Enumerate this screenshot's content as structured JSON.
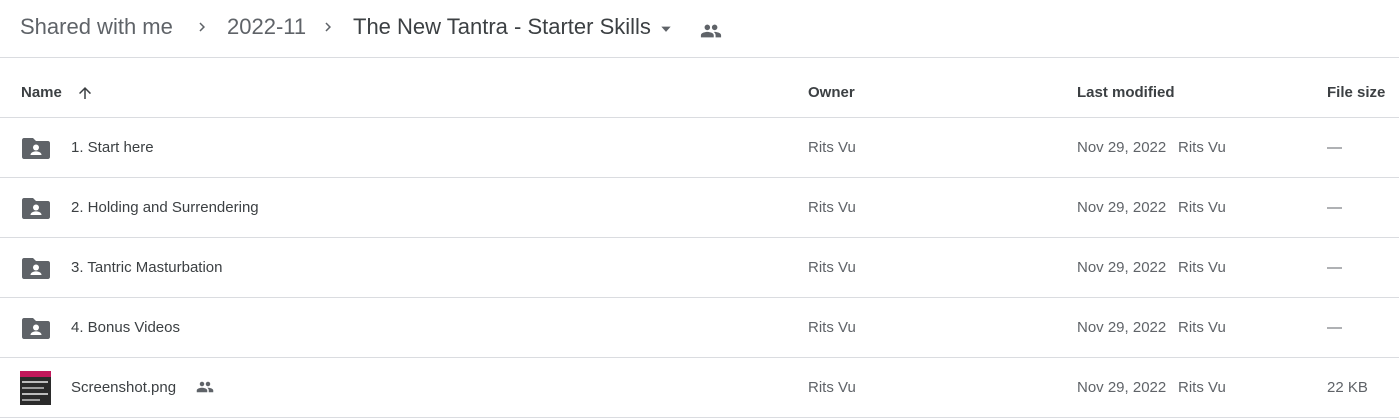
{
  "breadcrumb": {
    "items": [
      "Shared with me",
      "2022-11",
      "The New Tantra - Starter Skills"
    ]
  },
  "columns": {
    "name": "Name",
    "owner": "Owner",
    "last_modified": "Last modified",
    "file_size": "File size"
  },
  "sort": {
    "column": "Name",
    "direction": "ascending"
  },
  "files": [
    {
      "type": "shared-folder",
      "name": "1. Start here",
      "owner": "Rits Vu",
      "modified_date": "Nov 29, 2022",
      "modified_by": "Rits Vu",
      "size": "—"
    },
    {
      "type": "shared-folder",
      "name": "2. Holding and Surrendering",
      "owner": "Rits Vu",
      "modified_date": "Nov 29, 2022",
      "modified_by": "Rits Vu",
      "size": "—"
    },
    {
      "type": "shared-folder",
      "name": "3. Tantric Masturbation",
      "owner": "Rits Vu",
      "modified_date": "Nov 29, 2022",
      "modified_by": "Rits Vu",
      "size": "—"
    },
    {
      "type": "shared-folder",
      "name": "4. Bonus Videos",
      "owner": "Rits Vu",
      "modified_date": "Nov 29, 2022",
      "modified_by": "Rits Vu",
      "size": "—"
    },
    {
      "type": "image",
      "name": "Screenshot.png",
      "owner": "Rits Vu",
      "modified_date": "Nov 29, 2022",
      "modified_by": "Rits Vu",
      "size": "22 KB",
      "shared": true
    }
  ],
  "icons": {
    "separator": "chevron-right-icon",
    "dropdown": "arrow-drop-down-icon",
    "shared": "people-icon",
    "sort": "arrow-upward-icon",
    "folder": "shared-folder-icon"
  },
  "colors": {
    "icon_gray": "#5f6368",
    "divider": "#dadce0",
    "text": "#3c4043"
  }
}
